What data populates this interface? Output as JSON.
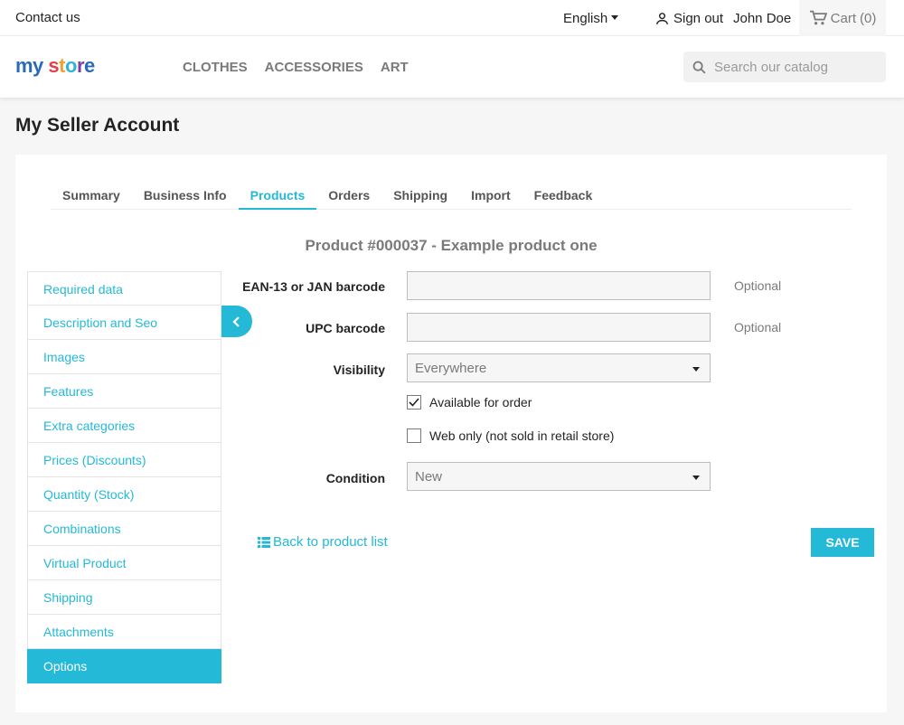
{
  "topbar": {
    "contact": "Contact us",
    "language": "English",
    "signout": "Sign out",
    "user": "John Doe",
    "cart": "Cart",
    "cart_count": "(0)"
  },
  "header": {
    "logo": [
      "my",
      " ",
      "s",
      "t",
      "o",
      "r",
      "e"
    ],
    "nav": [
      "Clothes",
      "Accessories",
      "Art"
    ],
    "search_placeholder": "Search our catalog"
  },
  "page": {
    "title": "My Seller Account"
  },
  "tabs": [
    "Summary",
    "Business Info",
    "Products",
    "Orders",
    "Shipping",
    "Import",
    "Feedback"
  ],
  "product_title": "Product #000037 - Example product one",
  "sidebar": [
    "Required data",
    "Description and Seo",
    "Images",
    "Features",
    "Extra categories",
    "Prices (Discounts)",
    "Quantity (Stock)",
    "Combinations",
    "Virtual Product",
    "Shipping",
    "Attachments",
    "Options"
  ],
  "form": {
    "ean_label": "EAN-13 or JAN barcode",
    "ean_value": "",
    "ean_hint": "Optional",
    "upc_label": "UPC barcode",
    "upc_value": "",
    "upc_hint": "Optional",
    "visibility_label": "Visibility",
    "visibility_value": "Everywhere",
    "available_label": "Available for order",
    "available_checked": true,
    "webonly_label": "Web only (not sold in retail store)",
    "webonly_checked": false,
    "condition_label": "Condition",
    "condition_value": "New"
  },
  "actions": {
    "back": "Back to product list",
    "save": "Save"
  },
  "colors": {
    "accent": "#24b9d7",
    "text": "#232323",
    "muted": "#7a7a7a"
  }
}
